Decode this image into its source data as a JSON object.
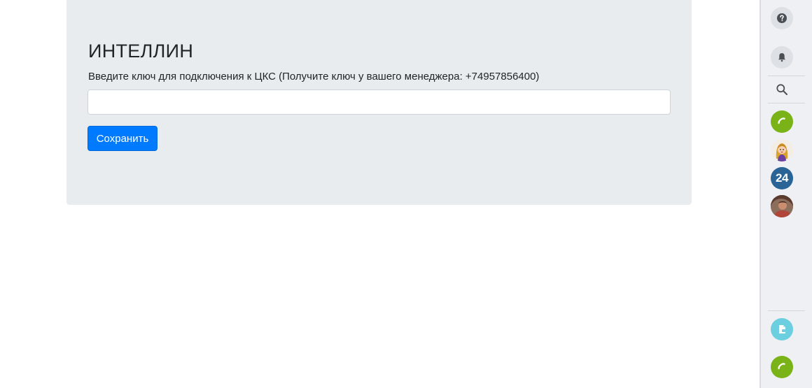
{
  "form": {
    "title": "ИНТЕЛЛИН",
    "label": "Введите ключ для подключения к ЦКС (Получите ключ у вашего менеджера: +74957856400)",
    "key_value": "",
    "save_label": "Сохранить"
  },
  "sidebar": {
    "items": [
      {
        "name": "help-icon"
      },
      {
        "name": "bell-icon"
      },
      {
        "name": "search-icon"
      },
      {
        "name": "phone-icon"
      },
      {
        "name": "avatar-cartoon-woman"
      },
      {
        "name": "bitrix24-icon",
        "label": "24"
      },
      {
        "name": "avatar-user-photo"
      },
      {
        "name": "document-icon"
      },
      {
        "name": "phone-icon"
      }
    ]
  },
  "colors": {
    "accent": "#007bff",
    "card_bg": "#e9ecef",
    "phone_green": "#7ab317",
    "teal": "#6ccfe0",
    "b24_blue": "#2a6496"
  }
}
